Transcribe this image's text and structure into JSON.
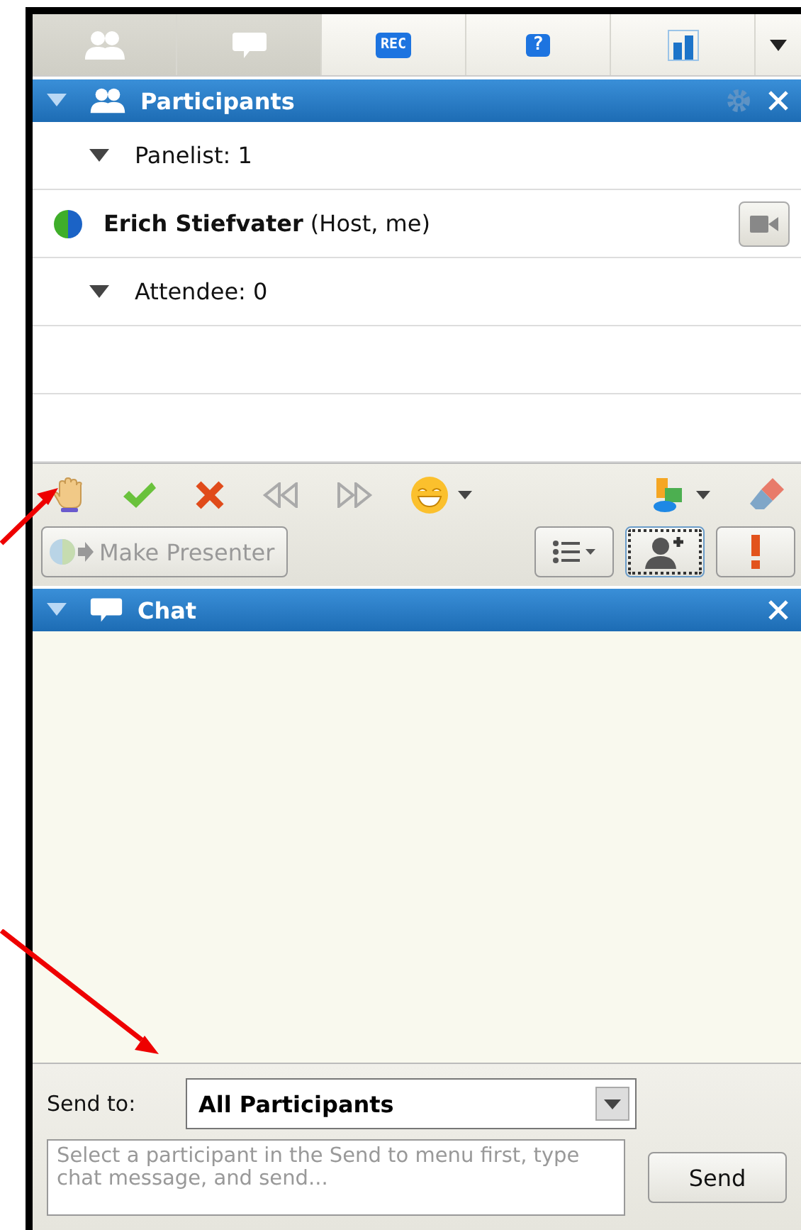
{
  "tabs": [
    {
      "kind": "people",
      "selected": true
    },
    {
      "kind": "chat",
      "selected": true
    },
    {
      "kind": "record",
      "label": "REC",
      "selected": false
    },
    {
      "kind": "help",
      "label": "?",
      "selected": false
    },
    {
      "kind": "poll",
      "selected": false
    }
  ],
  "participants_panel": {
    "title": "Participants",
    "expanded": true,
    "groups": [
      {
        "label": "Panelist: 1",
        "expanded": true,
        "members": [
          {
            "name": "**Erich Stiefvater** (Host, me)"
          }
        ]
      },
      {
        "label": "Attendee: 0",
        "expanded": true
      }
    ],
    "make_presenter": {
      "label": "Make Presenter",
      "disabled": true
    }
  },
  "chat_panel": {
    "title": "Chat",
    "expanded": true,
    "send_to_label": "Send to:",
    "send_to_value": "All Participants",
    "message_placeholder": "Select a participant in the Send to menu first, type chat message, and send...",
    "send_button": "Send"
  }
}
